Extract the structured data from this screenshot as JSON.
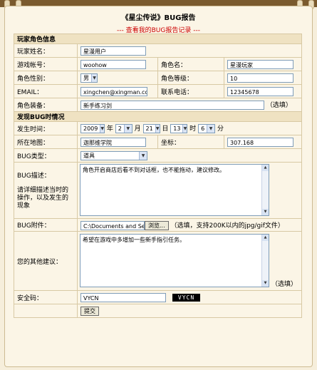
{
  "title": "《星尘传说》BUG报告",
  "sublink": "--- 查看我的BUG报告记录 ---",
  "sections": {
    "player": "玩家角色信息",
    "bug": "发现BUG时情况"
  },
  "player": {
    "name_label": "玩家姓名：",
    "name_value": "星漫用户",
    "account_label": "游戏帐号：",
    "account_value": "woohow",
    "role_label": "角色名：",
    "role_value": "星漫玩家",
    "gender_label": "角色性别：",
    "gender_value": "男",
    "level_label": "角色等级：",
    "level_value": "10",
    "email_label": "EMAIL：",
    "email_value": "xingchen@xingman.com",
    "phone_label": "联系电话：",
    "phone_value": "12345678",
    "equip_label": "角色装备：",
    "equip_value": "新手练习剑",
    "optional": "（选填）"
  },
  "bug": {
    "time_label": "发生时间：",
    "year": "2009",
    "year_unit": "年",
    "month": "2",
    "month_unit": "月",
    "day": "21",
    "day_unit": "日",
    "hour": "13",
    "hour_unit": "时",
    "minute": "6",
    "minute_unit": "分",
    "map_label": "所在地图：",
    "map_value": "迦那维学院",
    "coord_label": "坐标：",
    "coord_value": "307.168",
    "type_label": "BUG类型：",
    "type_value": "道具",
    "desc_label": "BUG描述：",
    "desc_hint": "请详细描述当时的操作，以及发生的现象",
    "desc_value": "角色开启商店后看不到对话框，也不能拖动，建议修改。",
    "attach_label": "BUG附件：",
    "attach_value": "C:\\Documents and Sett",
    "browse": "浏览...",
    "attach_hint": "（选填，支持200K以内的jpg/gif文件）",
    "suggest_label": "您的其他建议：",
    "suggest_value": "希望在游戏中多增加一些新手指引任务。",
    "suggest_opt": "（选填）",
    "code_label": "安全码：",
    "code_value": "VYCN",
    "captcha": "VYCN",
    "submit": "提交"
  }
}
